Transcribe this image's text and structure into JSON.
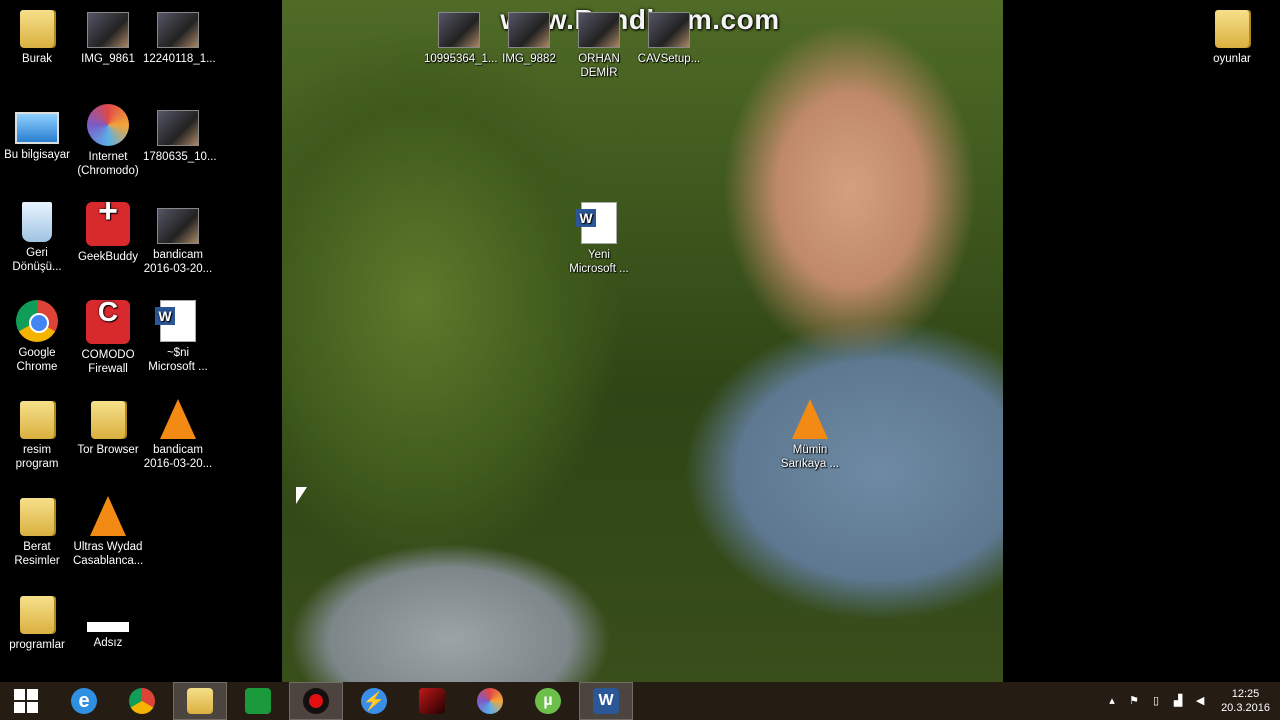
{
  "watermark": "www.Bandicam.com",
  "desktop_icons": [
    {
      "id": "burak",
      "label": "Burak",
      "icon": "folder-icon"
    },
    {
      "id": "img9861",
      "label": "IMG_9861",
      "icon": "photo-icon"
    },
    {
      "id": "img12240118",
      "label": "12240118_1...",
      "icon": "photo-icon"
    },
    {
      "id": "bu-bilgisayar",
      "label": "Bu bilgisayar",
      "icon": "computer-icon"
    },
    {
      "id": "internet-chromodo",
      "label": "Internet\n(Chromodo)",
      "icon": "chromodo-icon"
    },
    {
      "id": "img1780635",
      "label": "1780635_10...",
      "icon": "photo-icon"
    },
    {
      "id": "geri-donusum",
      "label": "Geri\nDönüşü...",
      "icon": "recycle-bin-icon"
    },
    {
      "id": "geekbuddy",
      "label": "GeekBuddy",
      "icon": "geekbuddy-icon"
    },
    {
      "id": "bandicam1",
      "label": "bandicam\n2016-03-20...",
      "icon": "photo-icon"
    },
    {
      "id": "google-chrome",
      "label": "Google\nChrome",
      "icon": "chrome-icon"
    },
    {
      "id": "comodo-firewall",
      "label": "COMODO\nFirewall",
      "icon": "comodo-icon"
    },
    {
      "id": "sni-microsoft",
      "label": "~$ni\nMicrosoft ...",
      "icon": "word-document-icon"
    },
    {
      "id": "resim-program",
      "label": "resim\nprogram",
      "icon": "folder-icon"
    },
    {
      "id": "tor-browser",
      "label": "Tor Browser",
      "icon": "folder-icon"
    },
    {
      "id": "bandicam2",
      "label": "bandicam\n2016-03-20...",
      "icon": "vlc-icon"
    },
    {
      "id": "berat-resimler",
      "label": "Berat\nResimler",
      "icon": "folder-icon"
    },
    {
      "id": "ultras-wydad",
      "label": "Ultras Wydad\nCasablanca...",
      "icon": "vlc-icon"
    },
    {
      "id": "programlar",
      "label": "programlar",
      "icon": "folder-icon"
    },
    {
      "id": "adsiz",
      "label": "Adsız",
      "icon": "blank-file-icon"
    },
    {
      "id": "img10995364",
      "label": "10995364_1...",
      "icon": "photo-icon"
    },
    {
      "id": "img9882",
      "label": "IMG_9882",
      "icon": "photo-icon"
    },
    {
      "id": "orhan-demir",
      "label": "ORHAN\nDEMİR",
      "icon": "photo-icon"
    },
    {
      "id": "cavsetup",
      "label": "CAVSetup...",
      "icon": "installer-icon"
    },
    {
      "id": "yeni-microsoft",
      "label": "Yeni\nMicrosoft ...",
      "icon": "word-document-icon"
    },
    {
      "id": "mumin-sarikaya",
      "label": "Mümin\nSarıkaya ...",
      "icon": "vlc-icon"
    },
    {
      "id": "oyunlar",
      "label": "oyunlar",
      "icon": "folder-icon"
    }
  ],
  "taskbar": {
    "items": [
      {
        "id": "start",
        "icon": "windows-start-icon"
      },
      {
        "id": "ie",
        "icon": "internet-explorer-icon"
      },
      {
        "id": "chrome",
        "icon": "chrome-icon"
      },
      {
        "id": "explorer",
        "icon": "file-explorer-icon"
      },
      {
        "id": "store",
        "icon": "store-icon"
      },
      {
        "id": "bandicam",
        "icon": "bandicam-record-icon"
      },
      {
        "id": "thunder",
        "icon": "lightning-app-icon"
      },
      {
        "id": "media",
        "icon": "media-app-icon"
      },
      {
        "id": "chromodo",
        "icon": "chromodo-icon"
      },
      {
        "id": "utorrent",
        "icon": "utorrent-icon"
      },
      {
        "id": "word",
        "icon": "word-icon"
      }
    ],
    "clock": {
      "time": "12:25",
      "date": "20.3.2016"
    }
  },
  "colors": {
    "taskbar": "#2a1e16",
    "vlc": "#f28a14",
    "word": "#2b5797"
  }
}
